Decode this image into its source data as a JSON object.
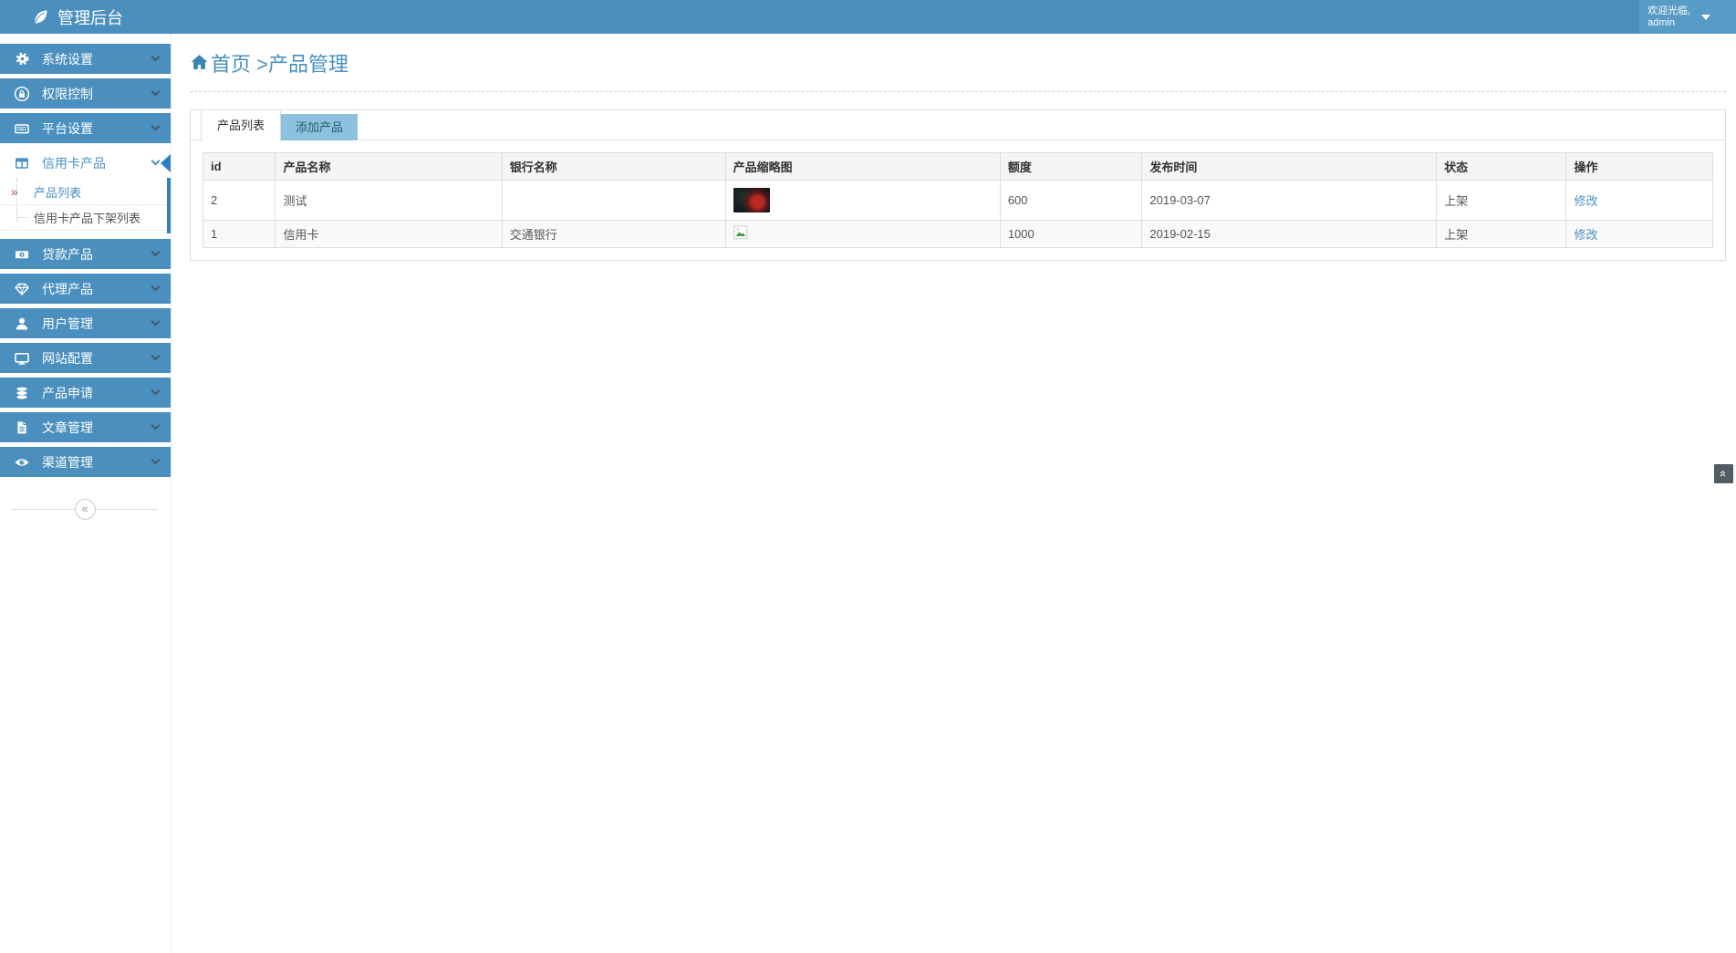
{
  "header": {
    "brand": "管理后台",
    "welcome_line1": "欢迎光临,",
    "welcome_line2": "admin"
  },
  "breadcrumb": {
    "home": "首页",
    "separator": " >",
    "current": "产品管理"
  },
  "sidebar": {
    "items": [
      {
        "label": "系统设置",
        "icon": "gear-icon"
      },
      {
        "label": "权限控制",
        "icon": "lock-icon"
      },
      {
        "label": "平台设置",
        "icon": "keyboard-icon"
      },
      {
        "label": "信用卡产品",
        "icon": "credit-card-icon",
        "active": true
      },
      {
        "label": "贷款产品",
        "icon": "banknote-icon"
      },
      {
        "label": "代理产品",
        "icon": "diamond-icon"
      },
      {
        "label": "用户管理",
        "icon": "user-icon"
      },
      {
        "label": "网站配置",
        "icon": "monitor-icon"
      },
      {
        "label": "产品申请",
        "icon": "database-icon"
      },
      {
        "label": "文章管理",
        "icon": "document-icon"
      },
      {
        "label": "渠道管理",
        "icon": "eye-icon"
      }
    ],
    "submenu": [
      {
        "label": "产品列表",
        "active": true
      },
      {
        "label": "信用卡产品下架列表",
        "active": false
      }
    ],
    "submenu_marker": "»",
    "collapse_glyph": "«"
  },
  "tabs": [
    {
      "label": "产品列表",
      "active": true
    },
    {
      "label": "添加产品",
      "active": false
    }
  ],
  "table": {
    "columns": [
      "id",
      "产品名称",
      "银行名称",
      "产品缩略图",
      "额度",
      "发布时间",
      "状态",
      "操作"
    ],
    "rows": [
      {
        "id": "2",
        "name": "测试",
        "bank": "",
        "thumb": "photo-thumbnail",
        "amount": "600",
        "date": "2019-03-07",
        "status": "上架",
        "action": "修改"
      },
      {
        "id": "1",
        "name": "信用卡",
        "bank": "交通银行",
        "thumb": "broken-image",
        "amount": "1000",
        "date": "2019-02-15",
        "status": "上架",
        "action": "修改"
      }
    ]
  },
  "back_to_top_glyph": "«",
  "colors": {
    "topbar": "#4a8fbe",
    "userbox": "#579bc7",
    "accent_link": "#4a90c2",
    "submenu_border": "#2e80c3",
    "inactive_tab_bg": "#8cc2dd",
    "table_header_bg": "#f5f5f5",
    "table_border": "#dddddd"
  }
}
